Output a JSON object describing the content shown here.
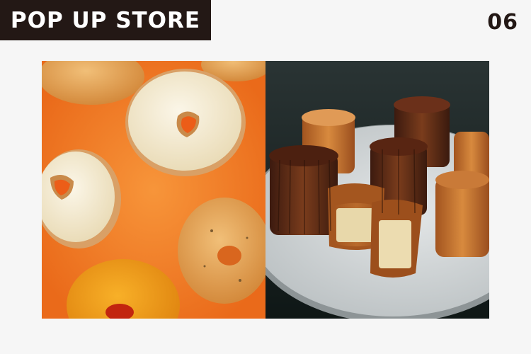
{
  "header": {
    "title": "POP UP STORE",
    "number": "06"
  },
  "photos": [
    {
      "subject": "bagels-with-cream-cheese-on-orange-background",
      "colors": {
        "bg": "#f26a1b",
        "bagel": "#e8a256",
        "cream": "#f3ead4"
      }
    },
    {
      "subject": "canneles-on-white-plate",
      "colors": {
        "bg": "#16201f",
        "plate": "#d7dadb",
        "cannele": "#5a2a18",
        "custard": "#e6d6a8"
      }
    }
  ]
}
